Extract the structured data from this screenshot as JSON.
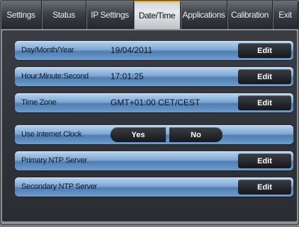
{
  "tabs": [
    {
      "label": "Settings",
      "active": false
    },
    {
      "label": "Status",
      "active": false
    },
    {
      "label": "IP Settings",
      "active": false
    },
    {
      "label": "Date/Time",
      "active": true
    },
    {
      "label": "Applications",
      "active": false
    },
    {
      "label": "Calibration",
      "active": false
    },
    {
      "label": "Exit",
      "active": false
    }
  ],
  "rows": {
    "date": {
      "label": "Day/Month/Year",
      "value": "19/04/2011",
      "button": "Edit"
    },
    "time": {
      "label": "Hour:Minute:Second",
      "value": "17:01:25",
      "button": "Edit"
    },
    "timezone": {
      "label": "Time Zone",
      "value": "GMT+01:00 CET/CEST",
      "button": "Edit"
    },
    "internet_clock": {
      "label": "Use Internet Clock",
      "yes": "Yes",
      "no": "No"
    },
    "primary_ntp": {
      "label": "Primary NTP Server",
      "value": "",
      "button": "Edit"
    },
    "secondary_ntp": {
      "label": "Secondary NTP Server",
      "value": "",
      "button": "Edit"
    }
  },
  "colors": {
    "active_tab_accent": "#f2a900",
    "row_blue": "#7fa7d1",
    "button_dark": "#15171b"
  }
}
